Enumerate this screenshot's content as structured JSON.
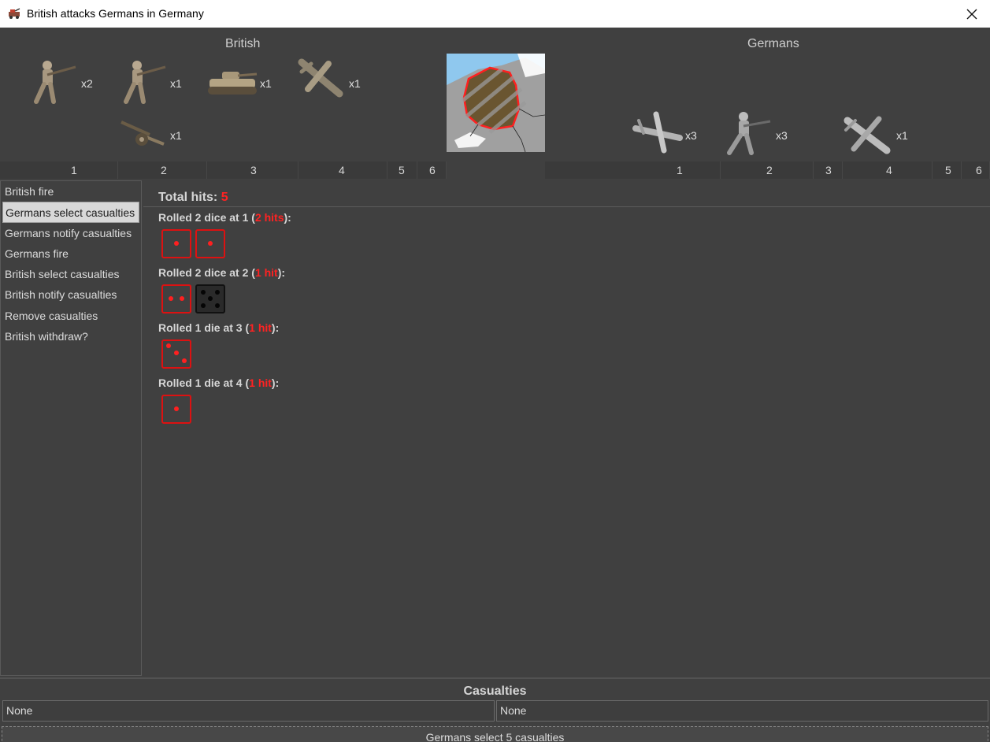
{
  "window": {
    "title": "British attacks Germans in Germany",
    "icon": "game-app-icon",
    "close_icon": "close-icon"
  },
  "attacker": {
    "name": "British",
    "units": [
      {
        "icon": "infantry-icon",
        "count": "x2"
      },
      {
        "icon": "infantry-icon",
        "count": "x1"
      },
      {
        "icon": "tank-icon",
        "count": "x1"
      },
      {
        "icon": "bomber-icon",
        "count": "x1"
      },
      {
        "icon": "artillery-icon",
        "count": "x1"
      }
    ],
    "columns": [
      "1",
      "2",
      "3",
      "4",
      "5",
      "6"
    ]
  },
  "defender": {
    "name": "Germans",
    "units": [
      {
        "icon": "fighter-icon",
        "count": "x3"
      },
      {
        "icon": "infantry-icon",
        "count": "x3"
      },
      {
        "icon": "fighter-icon",
        "count": "x1"
      }
    ],
    "columns": [
      "1",
      "2",
      "3",
      "4",
      "5",
      "6"
    ]
  },
  "territory": {
    "name": "Germany",
    "icon": "territory-map-icon"
  },
  "steps": [
    "British fire",
    "Germans select casualties",
    "Germans notify casualties",
    "Germans fire",
    "British select casualties",
    "British notify casualties",
    "Remove casualties",
    "British withdraw?"
  ],
  "active_step": "Germans select casualties",
  "dice_panel": {
    "total_label": "Total hits:",
    "total_value": "5",
    "rolls": [
      {
        "prefix": "Rolled 2 dice at 1 (",
        "hits": "2 hits",
        "suffix": "):",
        "dice": [
          {
            "value": 1,
            "hit": true
          },
          {
            "value": 1,
            "hit": true
          }
        ]
      },
      {
        "prefix": "Rolled 2 dice at 2 (",
        "hits": "1 hit",
        "suffix": "):",
        "dice": [
          {
            "value": 2,
            "hit": true
          },
          {
            "value": 5,
            "hit": false
          }
        ]
      },
      {
        "prefix": "Rolled 1 die at 3 (",
        "hits": "1 hit",
        "suffix": "):",
        "dice": [
          {
            "value": 3,
            "hit": true
          }
        ]
      },
      {
        "prefix": "Rolled 1 die at 4 (",
        "hits": "1 hit",
        "suffix": "):",
        "dice": [
          {
            "value": 1,
            "hit": true
          }
        ]
      }
    ]
  },
  "casualties": {
    "title": "Casualties",
    "left": "None",
    "right": "None"
  },
  "status_button": "Germans select 5 casualties",
  "colors": {
    "background": "#404040",
    "hit_red": "#ff2222",
    "titlebar": "#ffffff"
  }
}
